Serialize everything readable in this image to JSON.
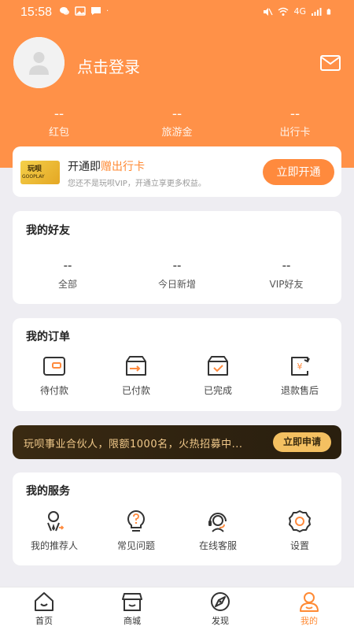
{
  "colors": {
    "header": "#ff9148",
    "accent": "#ff8a3d",
    "banner_bg": "#2e2210",
    "banner_text": "#f1c98a",
    "banner_button": "#f4c061",
    "tab_active": "#ff8a34"
  },
  "status_bar": {
    "time": "15:58",
    "right_text": "4G",
    "icons": [
      "wechat-icon",
      "image-icon",
      "message-icon",
      "mute-icon",
      "wifi-icon",
      "signal-icon",
      "battery-icon"
    ]
  },
  "profile": {
    "login_text": "点击登录",
    "avatar_icon": "user-avatar-icon",
    "mail_icon": "mail-icon"
  },
  "stats": [
    {
      "value": "--",
      "label": "红包"
    },
    {
      "value": "--",
      "label": "旅游金"
    },
    {
      "value": "--",
      "label": "出行卡"
    }
  ],
  "vip": {
    "logo_text": "玩呗",
    "logo_sub": "GOOPLAY",
    "title_prefix": "开通即",
    "title_highlight": "赠出行卡",
    "subtitle": "您还不是玩呗VIP，开通立享更多权益。",
    "button": "立即开通"
  },
  "friends": {
    "title": "我的好友",
    "items": [
      {
        "value": "--",
        "label": "全部"
      },
      {
        "value": "--",
        "label": "今日新增"
      },
      {
        "value": "--",
        "label": "VIP好友"
      }
    ]
  },
  "orders": {
    "title": "我的订单",
    "items": [
      {
        "label": "待付款",
        "icon": "wallet-icon"
      },
      {
        "label": "已付款",
        "icon": "paid-box-icon"
      },
      {
        "label": "已完成",
        "icon": "completed-box-icon"
      },
      {
        "label": "退款售后",
        "icon": "refund-icon"
      }
    ]
  },
  "banner": {
    "text": "玩呗事业合伙人，限额1000名，火热招募中...",
    "button": "立即申请"
  },
  "services": {
    "title": "我的服务",
    "items": [
      {
        "label": "我的推荐人",
        "icon": "referrer-icon"
      },
      {
        "label": "常见问题",
        "icon": "question-bulb-icon"
      },
      {
        "label": "在线客服",
        "icon": "customer-service-icon"
      },
      {
        "label": "设置",
        "icon": "settings-gear-icon"
      }
    ]
  },
  "tabs": [
    {
      "label": "首页",
      "icon": "home-icon",
      "active": false
    },
    {
      "label": "商城",
      "icon": "store-icon",
      "active": false
    },
    {
      "label": "发现",
      "icon": "discover-icon",
      "active": false
    },
    {
      "label": "我的",
      "icon": "profile-icon",
      "active": true
    }
  ]
}
